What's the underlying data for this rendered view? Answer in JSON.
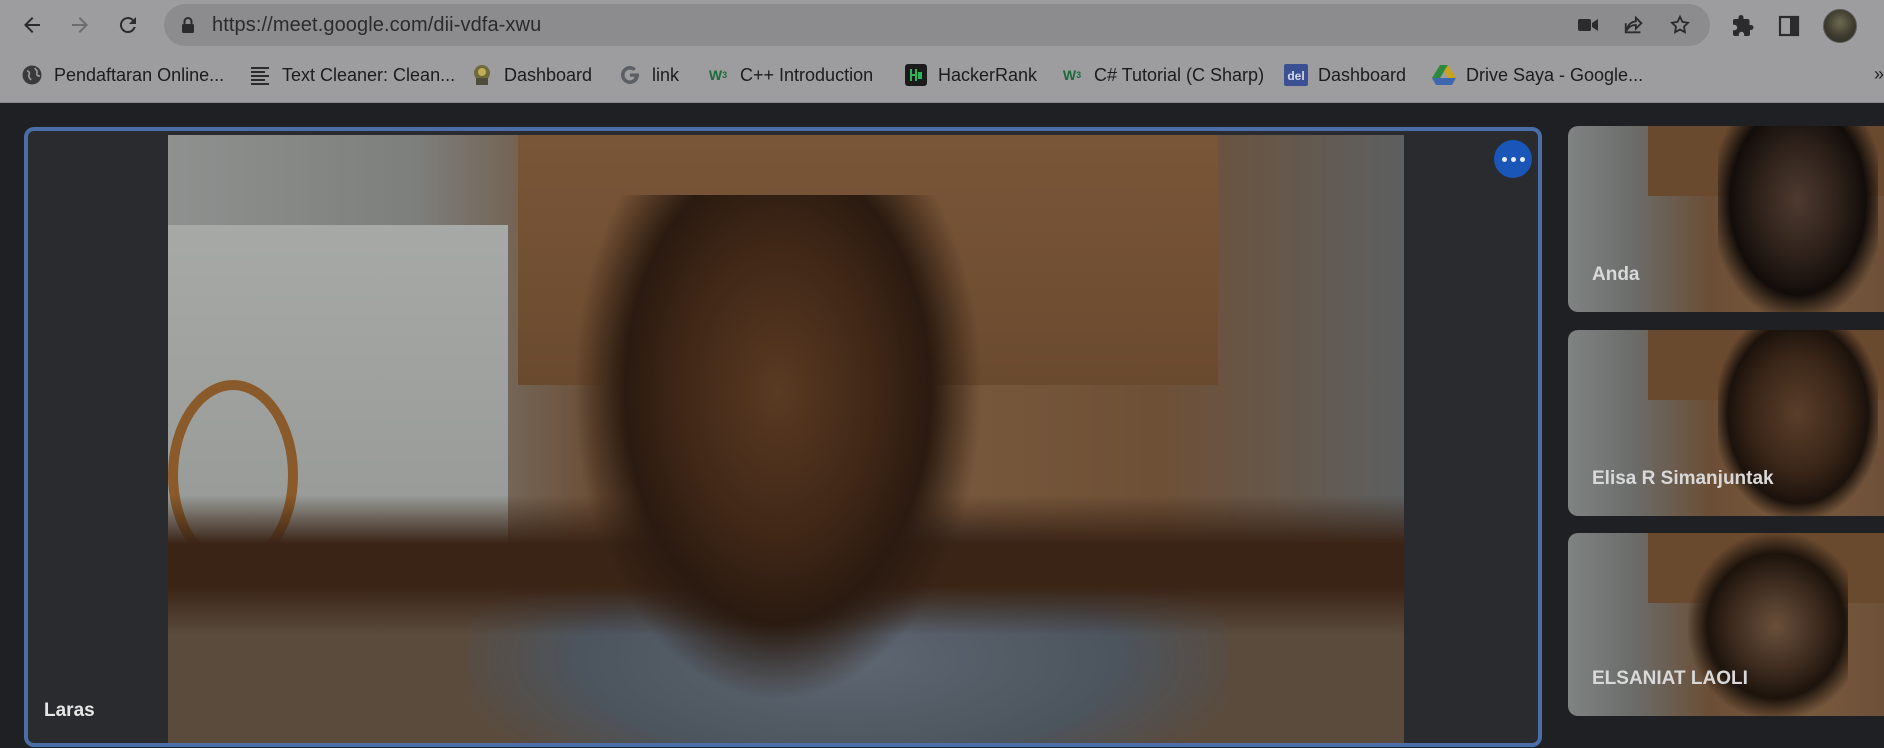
{
  "browser": {
    "url": "https://meet.google.com/dii-vdfa-xwu",
    "bookmarks": [
      {
        "label": "Pendaftaran Online...",
        "icon": "globe-icon"
      },
      {
        "label": "Text Cleaner: Clean...",
        "icon": "text-lines-icon"
      },
      {
        "label": "Dashboard",
        "icon": "dashboard-logo-icon"
      },
      {
        "label": "link",
        "icon": "google-g-icon"
      },
      {
        "label": "C++ Introduction",
        "icon": "w3schools-icon"
      },
      {
        "label": "HackerRank",
        "icon": "hackerrank-icon"
      },
      {
        "label": "C# Tutorial (C Sharp)",
        "icon": "w3schools-icon"
      },
      {
        "label": "Dashboard",
        "icon": "del-logo-icon"
      },
      {
        "label": "Drive Saya - Google...",
        "icon": "google-drive-icon"
      }
    ],
    "bookmarks_overflow": "»"
  },
  "meet": {
    "main": {
      "name": "Laras"
    },
    "participants": [
      {
        "name": "Anda"
      },
      {
        "name": "Elisa R Simanjuntak"
      },
      {
        "name": "ELSANIAT LAOLI"
      }
    ]
  },
  "colors": {
    "active_speaker_border": "#4b6da8",
    "more_options_button": "#1a56b8",
    "meet_background": "#1f2023"
  }
}
